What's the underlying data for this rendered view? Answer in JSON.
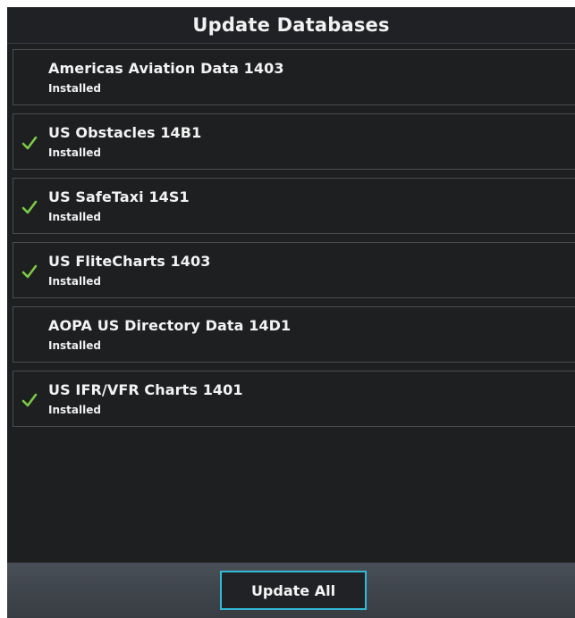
{
  "header": {
    "title": "Update Databases"
  },
  "databases": [
    {
      "name": "Americas Aviation Data 1403",
      "status": "Installed",
      "checked": false
    },
    {
      "name": "US Obstacles 14B1",
      "status": "Installed",
      "checked": true
    },
    {
      "name": "US SafeTaxi 14S1",
      "status": "Installed",
      "checked": true
    },
    {
      "name": "US FliteCharts 1403",
      "status": "Installed",
      "checked": true
    },
    {
      "name": "AOPA US Directory Data 14D1",
      "status": "Installed",
      "checked": false
    },
    {
      "name": "US IFR/VFR Charts 1401",
      "status": "Installed",
      "checked": true
    }
  ],
  "footer": {
    "update_all_label": "Update All"
  },
  "icons": {
    "check": "check-icon"
  },
  "colors": {
    "check": "#7ccb45",
    "button_border": "#33b9d6"
  }
}
